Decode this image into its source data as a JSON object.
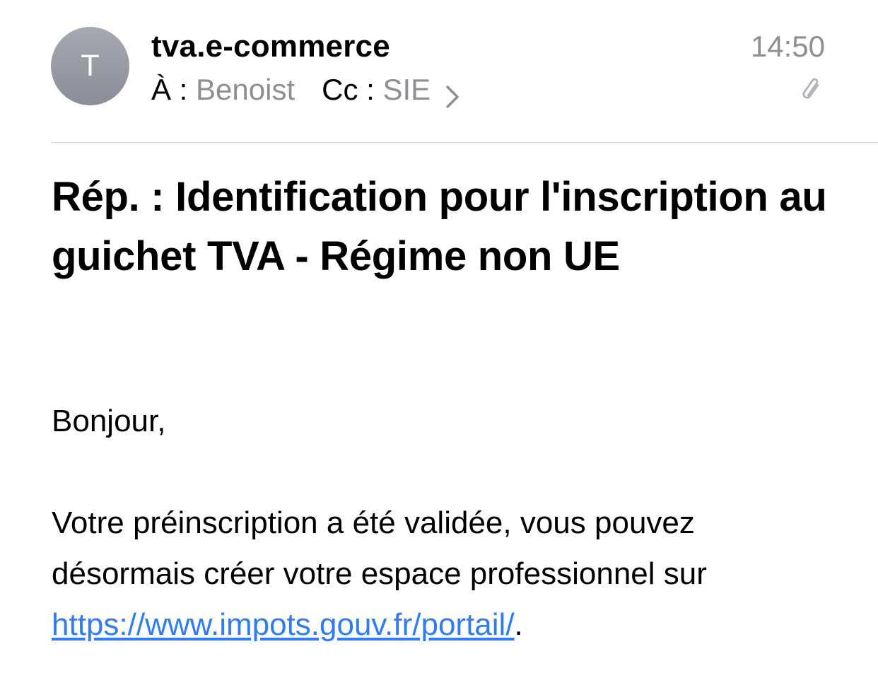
{
  "header": {
    "avatar_initial": "T",
    "sender": "tva.e-commerce",
    "to_label": "À :",
    "to_value": "Benoist",
    "cc_label": "Cc :",
    "cc_value": "SIE",
    "time": "14:50",
    "icons": [
      "chevron-right-icon",
      "paperclip-icon"
    ]
  },
  "subject": "Rép. : Identification pour l'inscription au guichet TVA - Régime non UE",
  "body": {
    "greeting": "Bonjour,",
    "paragraph_text": "Votre préinscription a été validée, vous pouvez désormais créer votre espace professionnel sur ",
    "link_text": "https://www.impots.gouv.fr/portail/",
    "trailing": "."
  },
  "colors": {
    "secondary_text": "#8e8e93",
    "link": "#2f7cf6",
    "avatar": "#9a9ca4",
    "divider": "#d1d1d6"
  }
}
